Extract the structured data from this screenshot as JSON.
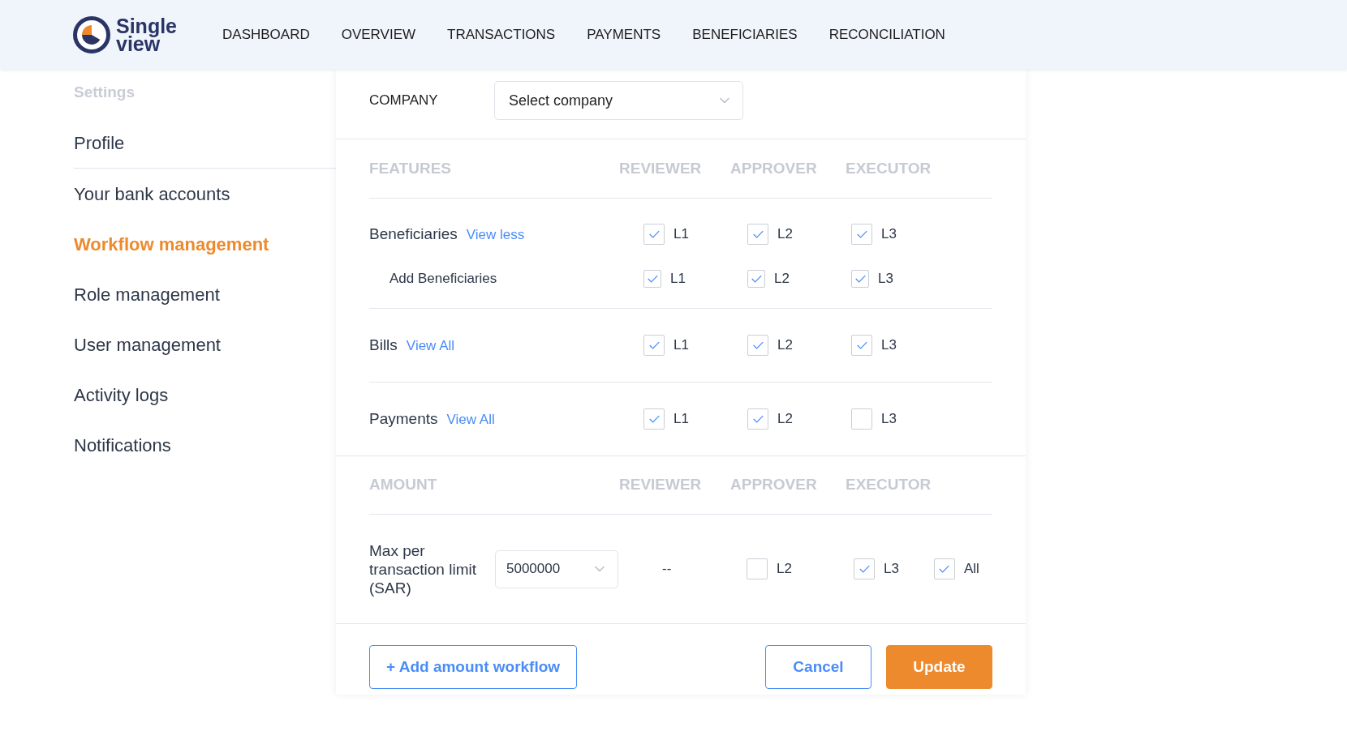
{
  "header": {
    "logo": {
      "line_1": "Single",
      "line_2": "view"
    },
    "nav": [
      {
        "label": "DASHBOARD"
      },
      {
        "label": "OVERVIEW"
      },
      {
        "label": "TRANSACTIONS"
      },
      {
        "label": "PAYMENTS"
      },
      {
        "label": "BENEFICIARIES"
      },
      {
        "label": "RECONCILIATION"
      }
    ]
  },
  "sidebar": {
    "title": "Settings",
    "sections": [
      {
        "items": [
          {
            "label": "Profile",
            "selected": false
          }
        ]
      },
      {
        "items": [
          {
            "label": "Your bank accounts",
            "selected": false
          },
          {
            "label": "Workflow management",
            "selected": true
          },
          {
            "label": "Role management",
            "selected": false
          },
          {
            "label": "User management",
            "selected": false
          },
          {
            "label": "Activity logs",
            "selected": false
          },
          {
            "label": "Notifications",
            "selected": false
          }
        ]
      }
    ]
  },
  "company": {
    "label": "COMPANY",
    "select": {
      "placeholder": "Select company"
    }
  },
  "features": {
    "columns": [
      "FEATURES",
      "REVIEWER",
      "APPROVER",
      "EXECUTOR"
    ],
    "rows": [
      {
        "cells": [
          {
            "kind": "feature",
            "name": "Beneficiaries",
            "link": "View less"
          },
          {
            "kind": "check",
            "label": "L1",
            "checked": true
          },
          {
            "kind": "check",
            "label": "L2",
            "checked": true
          },
          {
            "kind": "check",
            "label": "L3",
            "checked": true
          }
        ],
        "children": [
          {
            "cells": [
              {
                "kind": "feature",
                "name": "Add Beneficiaries"
              },
              {
                "kind": "check",
                "label": "L1",
                "checked": true
              },
              {
                "kind": "check",
                "label": "L2",
                "checked": true
              },
              {
                "kind": "check",
                "label": "L3",
                "checked": true
              }
            ]
          }
        ]
      },
      {
        "cells": [
          {
            "kind": "feature",
            "name": "Bills",
            "link": "View All"
          },
          {
            "kind": "check",
            "label": "L1",
            "checked": true
          },
          {
            "kind": "check",
            "label": "L2",
            "checked": true
          },
          {
            "kind": "check",
            "label": "L3",
            "checked": true
          }
        ]
      },
      {
        "cells": [
          {
            "kind": "feature",
            "name": "Payments",
            "link": "View All"
          },
          {
            "kind": "check",
            "label": "L1",
            "checked": true
          },
          {
            "kind": "check",
            "label": "L2",
            "checked": true
          },
          {
            "kind": "check",
            "label": "L3",
            "checked": false
          }
        ]
      }
    ]
  },
  "amount": {
    "columns": [
      "AMOUNT",
      "REVIEWER",
      "APPROVER",
      "EXECUTOR"
    ],
    "rows": [
      {
        "cells": [
          {
            "kind": "limit",
            "label": "Max per transaction limit (SAR)",
            "select": {
              "value": "5000000"
            }
          },
          {
            "kind": "text",
            "text": "--"
          },
          {
            "kind": "checks",
            "items": [
              {
                "label": "L2",
                "checked": false
              }
            ]
          },
          {
            "kind": "checks",
            "items": [
              {
                "label": "L3",
                "checked": true
              },
              {
                "label": "All",
                "checked": true
              }
            ]
          }
        ]
      }
    ]
  },
  "actions": {
    "left": [
      {
        "label": "+ Add amount workflow",
        "kind": "secondary"
      }
    ],
    "right": [
      {
        "label": "Cancel",
        "kind": "secondary"
      },
      {
        "label": "Update",
        "kind": "primary"
      }
    ]
  }
}
